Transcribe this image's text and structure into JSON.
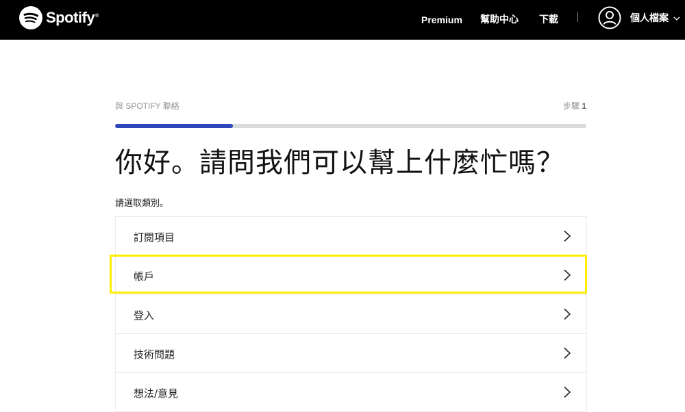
{
  "header": {
    "brand": "Spotify",
    "brand_mark": "®",
    "nav": {
      "premium": "Premium",
      "help": "幫助中心",
      "download": "下載"
    },
    "profile_label": "個人檔案"
  },
  "contact": {
    "step_label": "與 SPOTIFY 聯絡",
    "step_prefix": "步驟",
    "step_number": "1",
    "progress": 0.25,
    "heading": "你好。請問我們可以幫上什麼忙嗎？",
    "prompt": "請選取類別。",
    "categories": [
      {
        "label": "訂閱項目"
      },
      {
        "label": "帳戶",
        "highlighted": true
      },
      {
        "label": "登入"
      },
      {
        "label": "技術問題"
      },
      {
        "label": "想法/意見"
      }
    ]
  },
  "colors": {
    "topbar": "#000000",
    "brand_green": "#1ed760",
    "progress_fill": "#2d46b9",
    "progress_track": "#d9dadc",
    "highlight": "#ffec00"
  },
  "icons": {
    "logo": "spotify-logo-icon",
    "avatar": "user-avatar-icon",
    "dropdown": "chevron-down-icon",
    "row_arrow": "chevron-right-icon"
  }
}
